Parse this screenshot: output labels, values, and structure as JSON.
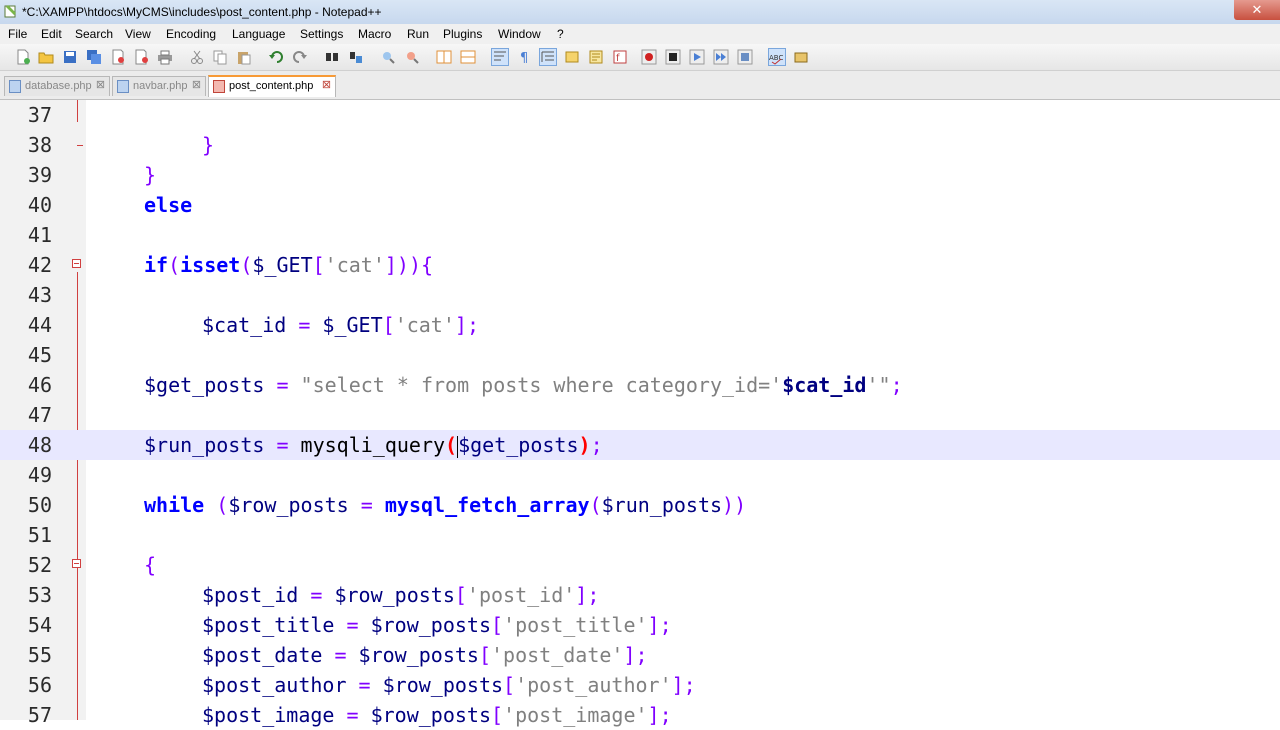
{
  "window": {
    "title": "*C:\\XAMPP\\htdocs\\MyCMS\\includes\\post_content.php - Notepad++",
    "close_glyph": "✕"
  },
  "menu": [
    "File",
    "Edit",
    "Search",
    "View",
    "Encoding",
    "Language",
    "Settings",
    "Macro",
    "Run",
    "Plugins",
    "Window",
    "?"
  ],
  "toolbar": {
    "icons": [
      "new-file-icon",
      "open-file-icon",
      "save-icon",
      "save-all-icon",
      "close-icon",
      "close-all-icon",
      "print-icon",
      "cut-icon",
      "copy-icon",
      "paste-icon",
      "undo-icon",
      "redo-icon",
      "find-icon",
      "replace-icon",
      "zoom-in-icon",
      "zoom-out-icon",
      "sync-v-icon",
      "sync-h-icon",
      "word-wrap-icon",
      "show-all-chars-icon",
      "indent-guide-icon",
      "user-lang-icon",
      "doc-map-icon",
      "function-list-icon",
      "record-macro-icon",
      "stop-macro-icon",
      "play-macro-icon",
      "run-macro-multiple-icon",
      "save-macro-icon",
      "spell-check-icon",
      "plugin-icon"
    ]
  },
  "tabs": [
    {
      "label": "database.php",
      "active": false
    },
    {
      "label": "navbar.php",
      "active": false
    },
    {
      "label": "post_content.php",
      "active": true
    }
  ],
  "editor": {
    "lines": [
      {
        "n": "37"
      },
      {
        "n": "38"
      },
      {
        "n": "39"
      },
      {
        "n": "40"
      },
      {
        "n": "41"
      },
      {
        "n": "42"
      },
      {
        "n": "43"
      },
      {
        "n": "44"
      },
      {
        "n": "45"
      },
      {
        "n": "46"
      },
      {
        "n": "47"
      },
      {
        "n": "48"
      },
      {
        "n": "49"
      },
      {
        "n": "50"
      },
      {
        "n": "51"
      },
      {
        "n": "52"
      },
      {
        "n": "53"
      },
      {
        "n": "54"
      },
      {
        "n": "55"
      },
      {
        "n": "56"
      },
      {
        "n": "57"
      }
    ],
    "t": {
      "brace_close": "}",
      "else": "else",
      "if": "if",
      "isset": "isset",
      "get": "$_GET",
      "cat_str": "'cat'",
      "cat_id": "$cat_id",
      "get_posts": "$get_posts",
      "sql_str": "\"select * from posts where category_id='",
      "sql_end": "'\"",
      "run_posts": "$run_posts",
      "mysqli_query": "mysqli_query",
      "while": "while",
      "row_posts": "$row_posts",
      "mysql_fetch_array": "mysql_fetch_array",
      "brace_open": "{",
      "post_id": "$post_id",
      "post_title": "$post_title",
      "post_date": "$post_date",
      "post_author": "$post_author",
      "post_image": "$post_image",
      "k_post_id": "'post_id'",
      "k_post_title": "'post_title'",
      "k_post_date": "'post_date'",
      "k_post_author": "'post_author'",
      "k_post_image": "'post_image'"
    }
  }
}
